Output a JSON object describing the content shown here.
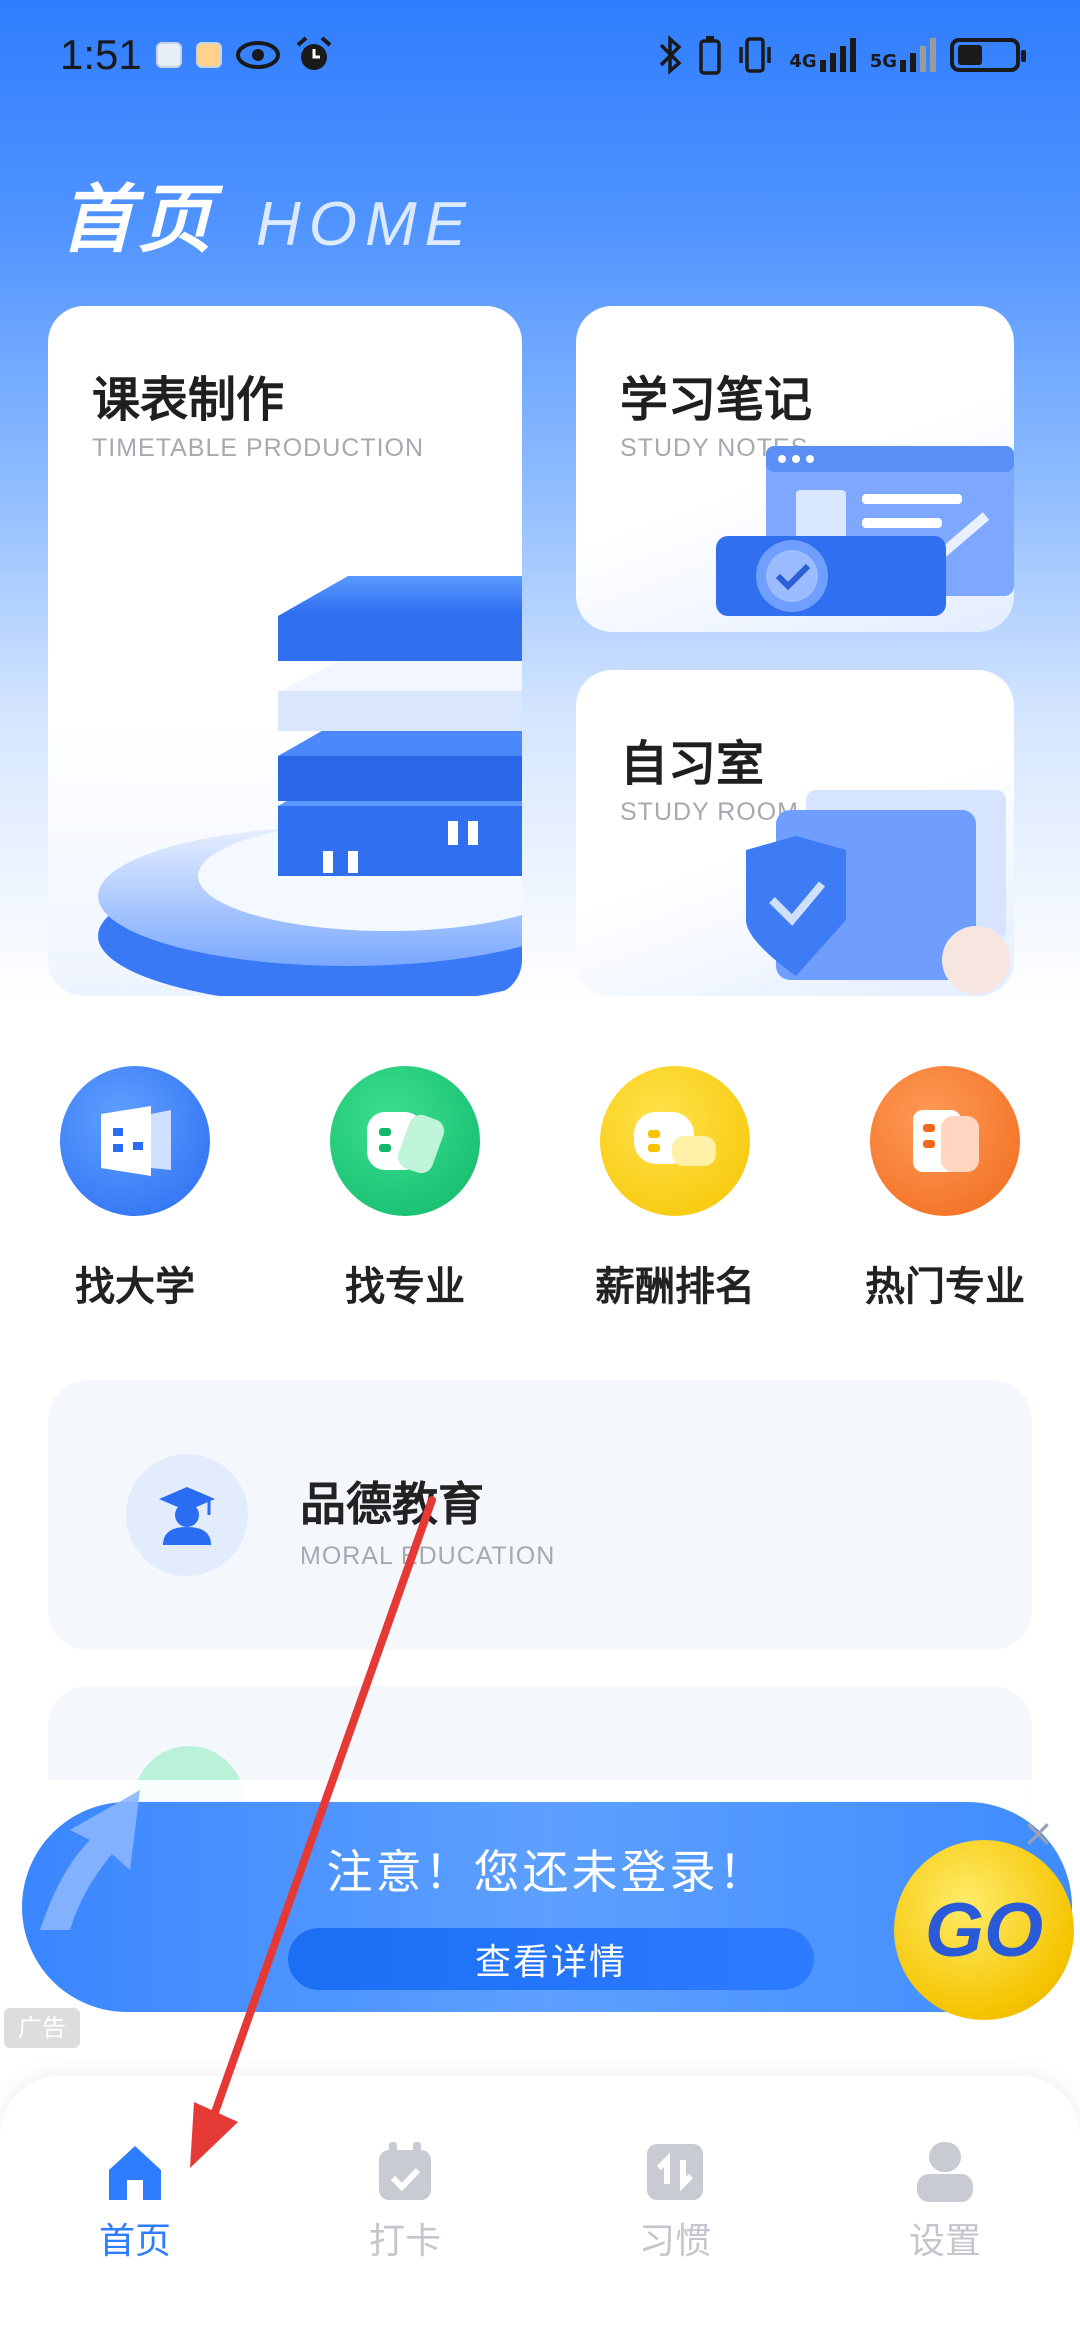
{
  "status_bar": {
    "time": "1:51",
    "net_4g": "4G",
    "net_5g": "5G"
  },
  "header": {
    "title": "首页",
    "title_en": "HOME"
  },
  "cards": [
    {
      "title": "课表制作",
      "subtitle": "TIMETABLE PRODUCTION"
    },
    {
      "title": "学习笔记",
      "subtitle": "STUDY NOTES"
    },
    {
      "title": "自习室",
      "subtitle": "STUDY ROOM"
    }
  ],
  "quick_entries": [
    {
      "label": "找大学",
      "color": "#2a6cf2",
      "icon": "university-icon"
    },
    {
      "label": "找专业",
      "color": "#11b86a",
      "icon": "major-icon"
    },
    {
      "label": "薪酬排名",
      "color": "#f6c400",
      "icon": "salary-rank-icon"
    },
    {
      "label": "热门专业",
      "color": "#f06a1c",
      "icon": "hot-major-icon"
    }
  ],
  "list": [
    {
      "title": "品德教育",
      "subtitle": "MORAL EDUCATION",
      "icon": "graduate-icon"
    }
  ],
  "ad": {
    "text": "注意！您还未登录！",
    "button": "查看详情",
    "go": "GO",
    "tag": "广告",
    "close": "×"
  },
  "tabs": [
    {
      "label": "首页",
      "active": true,
      "icon": "home-icon"
    },
    {
      "label": "打卡",
      "active": false,
      "icon": "calendar-check-icon"
    },
    {
      "label": "习惯",
      "active": false,
      "icon": "habit-icon"
    },
    {
      "label": "设置",
      "active": false,
      "icon": "user-settings-icon"
    }
  ],
  "colors": {
    "primary": "#2f7dff",
    "inactive": "#c3c6cc",
    "annotation": "#e53935"
  }
}
